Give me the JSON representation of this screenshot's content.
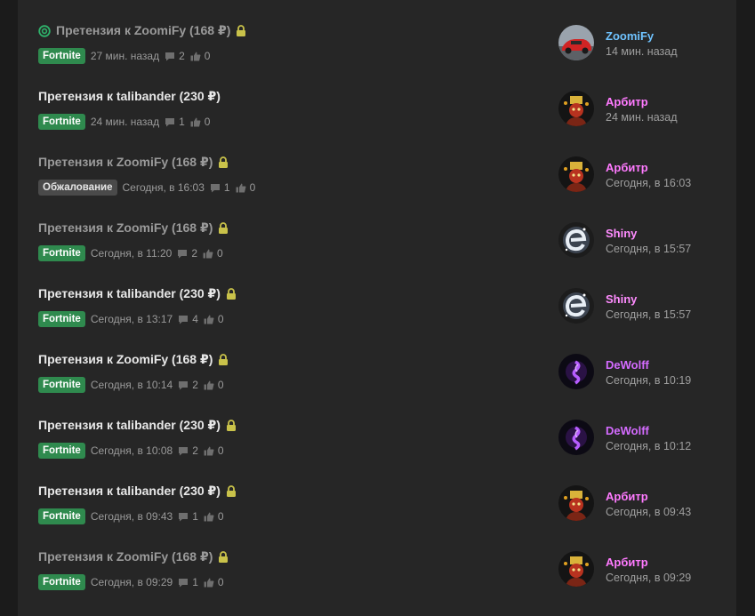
{
  "threads": [
    {
      "title": "Претензия к ZoomiFy (168 ₽)",
      "read": true,
      "watched": true,
      "locked": true,
      "tag": "Fortnite",
      "tag_style": "green",
      "date": "27 мин. назад",
      "replies": "2",
      "likes": "0",
      "last_user": "ZoomiFy",
      "last_user_color": "#6fc3ff",
      "last_time": "14 мин. назад",
      "avatar": "car-avatar"
    },
    {
      "title": "Претензия к talibander (230 ₽)",
      "read": false,
      "watched": false,
      "locked": false,
      "tag": "Fortnite",
      "tag_style": "green",
      "date": "24 мин. назад",
      "replies": "1",
      "likes": "0",
      "last_user": "Арбитр",
      "last_user_color": "#ff7aff",
      "last_time": "24 мин. назад",
      "avatar": "arbiter-avatar"
    },
    {
      "title": "Претензия к ZoomiFy (168 ₽)",
      "read": true,
      "watched": false,
      "locked": true,
      "tag": "Обжалование",
      "tag_style": "gray",
      "date": "Сегодня, в 16:03",
      "replies": "1",
      "likes": "0",
      "last_user": "Арбитр",
      "last_user_color": "#ff7aff",
      "last_time": "Сегодня, в 16:03",
      "avatar": "arbiter-avatar"
    },
    {
      "title": "Претензия к ZoomiFy (168 ₽)",
      "read": true,
      "watched": false,
      "locked": true,
      "tag": "Fortnite",
      "tag_style": "green",
      "date": "Сегодня, в 11:20",
      "replies": "2",
      "likes": "0",
      "last_user": "Shiny",
      "last_user_color": "#ff8cff",
      "last_time": "Сегодня, в 15:57",
      "avatar": "shiny-avatar"
    },
    {
      "title": "Претензия к talibander (230 ₽)",
      "read": false,
      "watched": false,
      "locked": true,
      "tag": "Fortnite",
      "tag_style": "green",
      "date": "Сегодня, в 13:17",
      "replies": "4",
      "likes": "0",
      "last_user": "Shiny",
      "last_user_color": "#ff8cff",
      "last_time": "Сегодня, в 15:57",
      "avatar": "shiny-avatar"
    },
    {
      "title": "Претензия к ZoomiFy (168 ₽)",
      "read": false,
      "watched": false,
      "locked": true,
      "tag": "Fortnite",
      "tag_style": "green",
      "date": "Сегодня, в 10:14",
      "replies": "2",
      "likes": "0",
      "last_user": "DeWolff",
      "last_user_color": "#d46bff",
      "last_time": "Сегодня, в 10:19",
      "avatar": "dewolff-avatar"
    },
    {
      "title": "Претензия к talibander (230 ₽)",
      "read": false,
      "watched": false,
      "locked": true,
      "tag": "Fortnite",
      "tag_style": "green",
      "date": "Сегодня, в 10:08",
      "replies": "2",
      "likes": "0",
      "last_user": "DeWolff",
      "last_user_color": "#d46bff",
      "last_time": "Сегодня, в 10:12",
      "avatar": "dewolff-avatar"
    },
    {
      "title": "Претензия к talibander (230 ₽)",
      "read": false,
      "watched": false,
      "locked": true,
      "tag": "Fortnite",
      "tag_style": "green",
      "date": "Сегодня, в 09:43",
      "replies": "1",
      "likes": "0",
      "last_user": "Арбитр",
      "last_user_color": "#ff7aff",
      "last_time": "Сегодня, в 09:43",
      "avatar": "arbiter-avatar"
    },
    {
      "title": "Претензия к ZoomiFy (168 ₽)",
      "read": true,
      "watched": false,
      "locked": true,
      "tag": "Fortnite",
      "tag_style": "green",
      "date": "Сегодня, в 09:29",
      "replies": "1",
      "likes": "0",
      "last_user": "Арбитр",
      "last_user_color": "#ff7aff",
      "last_time": "Сегодня, в 09:29",
      "avatar": "arbiter-avatar"
    }
  ],
  "icons": {
    "watch": "target-icon",
    "lock": "lock-icon",
    "replies": "comment-icon",
    "likes": "thumbs-up-icon"
  },
  "colors": {
    "tag_green": "#2f8a4e",
    "lock": "#c9c24a",
    "watch": "#2fb36b",
    "background": "#262626"
  }
}
